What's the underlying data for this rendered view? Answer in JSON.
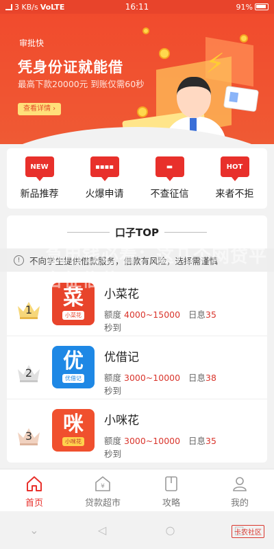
{
  "status_bar": {
    "speed": "3 KB/s",
    "network": "VoLTE",
    "time": "16:11",
    "battery": "91%"
  },
  "banner": {
    "logo": "审批快",
    "title": "凭身份证就能借",
    "subtitle": "最高下款20000元 到账仅需60秒",
    "button": "查看详情 ›"
  },
  "menu": [
    {
      "icon_text": "NEW",
      "label": "新品推荐"
    },
    {
      "icon_text": "▪▪▪▪",
      "label": "火爆申请"
    },
    {
      "icon_text": "▬",
      "label": "不查征信"
    },
    {
      "icon_text": "HOT",
      "label": "来者不拒"
    }
  ],
  "ranking": {
    "title": "口子TOP",
    "items": [
      {
        "rank": "1",
        "name": "小菜花",
        "logo_big": "菜",
        "logo_small": "小菜花",
        "logo_color": "#e8442b",
        "amount_label": "额度",
        "amount": "4000~15000",
        "rate_label": "日息",
        "rate": "35",
        "speed": "秒到"
      },
      {
        "rank": "2",
        "name": "优借记",
        "logo_big": "优",
        "logo_small": "优借记",
        "logo_color": "#1e88e5",
        "amount_label": "额度",
        "amount": "3000~10000",
        "rate_label": "日息",
        "rate": "38",
        "speed": "秒到"
      },
      {
        "rank": "3",
        "name": "小咪花",
        "logo_big": "咪",
        "logo_small": "小咪花",
        "logo_color": "#f0502e",
        "amount_label": "额度",
        "amount": "3000~10000",
        "rate_label": "日息",
        "rate": "35",
        "speed": "秒到"
      }
    ]
  },
  "warning": {
    "text": "不向学生提供借款服务，借款有风险，选择需谨慎"
  },
  "overlay": {
    "headline": "急用钱必看：这几个网贷平台征信花"
  },
  "bottom_nav": [
    {
      "label": "首页",
      "icon": "home-icon",
      "active": true
    },
    {
      "label": "贷款超市",
      "icon": "market-icon",
      "active": false
    },
    {
      "label": "攻略",
      "icon": "guide-icon",
      "active": false
    },
    {
      "label": "我的",
      "icon": "profile-icon",
      "active": false
    }
  ],
  "watermark": "卡农社区",
  "colors": {
    "brand": "#e8302b",
    "banner": "#f14b2d"
  }
}
